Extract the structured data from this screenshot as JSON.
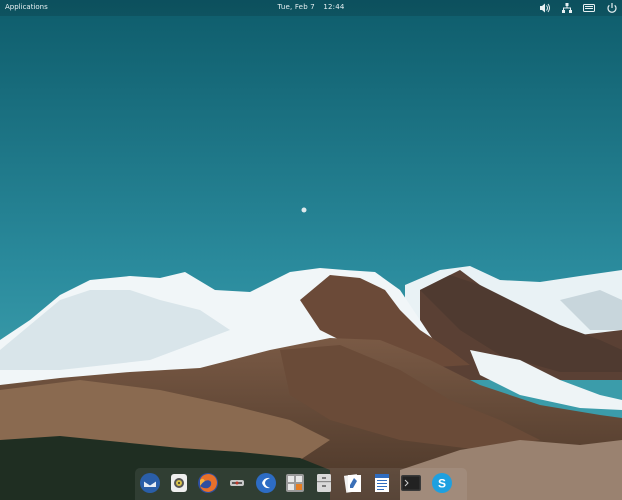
{
  "panel": {
    "applications_label": "Applications",
    "clock_day": "Tue, Feb  7",
    "clock_time": "12:44",
    "indicators": [
      "volume-icon",
      "network-icon",
      "keyboard-icon",
      "power-icon"
    ]
  },
  "dock": {
    "items": [
      {
        "name": "thunderbird",
        "icon": "mail-client-icon",
        "running": false
      },
      {
        "name": "music-player",
        "icon": "music-player-icon",
        "running": false
      },
      {
        "name": "firefox",
        "icon": "web-browser-icon",
        "running": false
      },
      {
        "name": "transmission",
        "icon": "transmission-icon",
        "running": false
      },
      {
        "name": "software-center",
        "icon": "software-center-icon",
        "running": false
      },
      {
        "name": "calculator",
        "icon": "calculator-icon",
        "running": false
      },
      {
        "name": "archive-manager",
        "icon": "archive-icon",
        "running": false
      },
      {
        "name": "text-editor",
        "icon": "text-editor-icon",
        "running": false
      },
      {
        "name": "document-viewer",
        "icon": "document-icon",
        "running": false
      },
      {
        "name": "terminal",
        "icon": "terminal-icon",
        "running": false
      },
      {
        "name": "skype",
        "icon": "skype-icon",
        "running": false
      }
    ]
  },
  "colors": {
    "sky_top": "#0f5f6d",
    "sky_bottom": "#3a99a9",
    "panel_text": "#e8f1f3"
  }
}
